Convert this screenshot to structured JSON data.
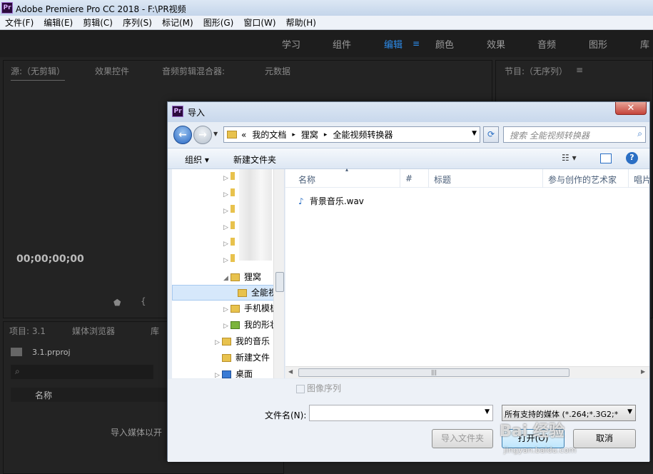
{
  "app": {
    "title": "Adobe Premiere Pro CC 2018 - F:\\PR视频",
    "logo": "Pr"
  },
  "menu": [
    "文件(F)",
    "编辑(E)",
    "剪辑(C)",
    "序列(S)",
    "标记(M)",
    "图形(G)",
    "窗口(W)",
    "帮助(H)"
  ],
  "workspaces": [
    "学习",
    "组件",
    "编辑",
    "颜色",
    "效果",
    "音频",
    "图形",
    "库"
  ],
  "active_workspace": "编辑",
  "source_panel": {
    "tabs": [
      "源:（无剪辑）",
      "效果控件",
      "音频剪辑混合器:",
      "元数据"
    ],
    "timecode": "00;00;00;00"
  },
  "program_panel": {
    "tab": "节目:（无序列）"
  },
  "project_panel": {
    "tabs": [
      "项目: 3.1",
      "媒体浏览器",
      "库"
    ],
    "file": "3.1.prproj",
    "column_name": "名称",
    "hint": "导入媒体以开"
  },
  "dialog": {
    "title": "导入",
    "close": "✕",
    "breadcrumb": [
      "«",
      "我的文档",
      "▸",
      "狸窝",
      "▸",
      "全能视频转换器"
    ],
    "search_placeholder": "搜索 全能视频转换器",
    "toolbar": {
      "organize": "组织 ▾",
      "new_folder": "新建文件夹"
    },
    "tree": [
      {
        "label": "狸窝",
        "expanded": true
      },
      {
        "label": "全能视",
        "selected": true
      },
      {
        "label": "手机模板"
      },
      {
        "label": "我的形状"
      },
      {
        "label": "我的音乐"
      },
      {
        "label": "新建文件"
      },
      {
        "label": "桌面"
      }
    ],
    "columns": [
      "名称",
      "#",
      "标题",
      "参与创作的艺术家",
      "唱片"
    ],
    "files": [
      {
        "name": "背景音乐.wav",
        "icon": "audio-file-icon"
      }
    ],
    "image_sequence": "图像序列",
    "filename_label": "文件名(N):",
    "filename_value": "",
    "filter": "所有支持的媒体 (*.264;*.3G2;*",
    "buttons": {
      "import_folder": "导入文件夹",
      "open": "打开(O)",
      "cancel": "取消"
    }
  },
  "watermark": {
    "line1": "Bai 经验",
    "line2": "jingyan.baidu.com"
  },
  "colors": {
    "accent": "#2d8ceb",
    "dialog_bg": "#e7edf5",
    "app_bg": "#232323"
  }
}
